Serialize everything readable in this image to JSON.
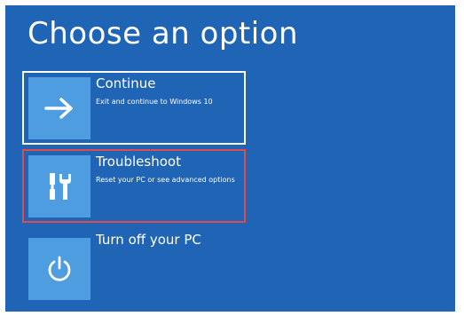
{
  "page": {
    "title": "Choose an option"
  },
  "options": [
    {
      "label": "Continue",
      "description": "Exit and continue to Windows 10",
      "icon": "arrow-right-icon"
    },
    {
      "label": "Troubleshoot",
      "description": "Reset your PC or see advanced options",
      "icon": "tools-icon"
    },
    {
      "label": "Turn off your PC",
      "description": "",
      "icon": "power-icon"
    }
  ],
  "colors": {
    "background": "#1f64b5",
    "tile": "#4d9de0",
    "selected_border": "#ffffff",
    "highlight_border": "#e04a4a"
  }
}
